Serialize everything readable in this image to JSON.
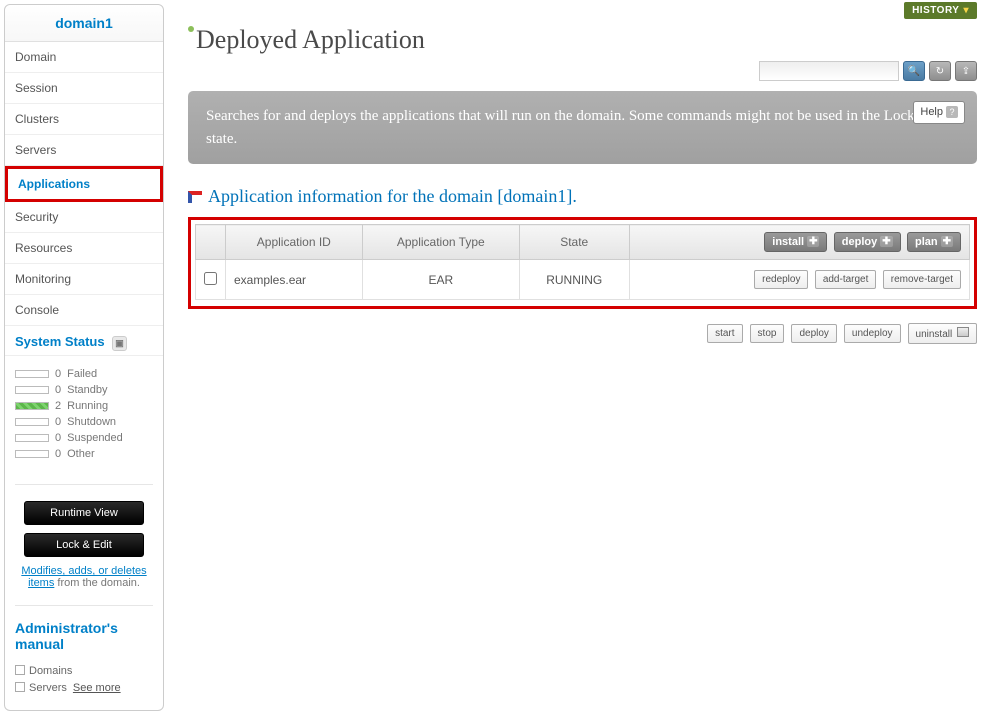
{
  "sidebar": {
    "title": "domain1",
    "nav": {
      "domain": "Domain",
      "session": "Session",
      "clusters": "Clusters",
      "servers": "Servers",
      "applications": "Applications",
      "security": "Security",
      "resources": "Resources",
      "monitoring": "Monitoring",
      "console": "Console"
    },
    "system_status": {
      "title": "System Status",
      "failed": {
        "count": "0",
        "label": "Failed"
      },
      "standby": {
        "count": "0",
        "label": "Standby"
      },
      "running": {
        "count": "2",
        "label": "Running"
      },
      "shutdown": {
        "count": "0",
        "label": "Shutdown"
      },
      "suspended": {
        "count": "0",
        "label": "Suspended"
      },
      "other": {
        "count": "0",
        "label": "Other"
      }
    },
    "buttons": {
      "runtime_view": "Runtime View",
      "lock_edit": "Lock & Edit"
    },
    "mod_text": {
      "link": "Modifies, adds, or deletes items",
      "rest": " from the domain."
    },
    "admin": {
      "title": "Administrator's manual",
      "domains": "Domains",
      "servers": "Servers",
      "see_more": "See more"
    }
  },
  "top": {
    "history": "HISTORY",
    "search_placeholder": ""
  },
  "page": {
    "title": "Deployed Application",
    "desc": "Searches for and deploys the applications that will run on the domain. Some commands might not be used in the Lock & Edit state.",
    "help": "Help",
    "section_title": "Application information for the domain [domain1]."
  },
  "table": {
    "headers": {
      "app_id": "Application ID",
      "app_type": "Application Type",
      "state": "State"
    },
    "head_buttons": {
      "install": "install",
      "deploy": "deploy",
      "plan": "plan"
    },
    "row": {
      "app_id": "examples.ear",
      "app_type": "EAR",
      "state": "RUNNING",
      "buttons": {
        "redeploy": "redeploy",
        "add_target": "add-target",
        "remove_target": "remove-target"
      }
    }
  },
  "actions": {
    "start": "start",
    "stop": "stop",
    "deploy": "deploy",
    "undeploy": "undeploy",
    "uninstall": "uninstall"
  }
}
